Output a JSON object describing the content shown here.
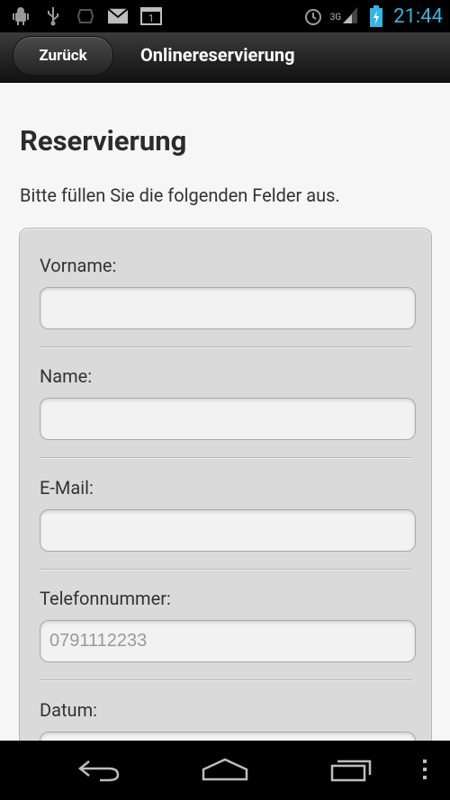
{
  "status_bar": {
    "time": "21:44",
    "network": "3G",
    "calendar_day": "1",
    "icons": [
      "android-debug-icon",
      "usb-icon",
      "notification-icon",
      "mail-icon",
      "calendar-icon",
      "alarm-icon",
      "signal-icon",
      "battery-charging-icon"
    ]
  },
  "header": {
    "back_label": "Zurück",
    "title": "Onlinereservierung"
  },
  "page": {
    "title": "Reservierung",
    "intro": "Bitte füllen Sie die folgenden Felder aus."
  },
  "form": {
    "fields": [
      {
        "label": "Vorname:",
        "value": "",
        "placeholder": ""
      },
      {
        "label": "Name:",
        "value": "",
        "placeholder": ""
      },
      {
        "label": "E-Mail:",
        "value": "",
        "placeholder": ""
      },
      {
        "label": "Telefonnummer:",
        "value": "",
        "placeholder": "0791112233"
      },
      {
        "label": "Datum:",
        "value": "",
        "placeholder": ""
      }
    ]
  },
  "navbar": {
    "icons": [
      "back-nav-icon",
      "home-nav-icon",
      "recent-apps-icon",
      "overflow-menu-icon"
    ]
  },
  "colors": {
    "accent": "#33b5e5",
    "header_dark": "#1c1c1c",
    "form_bg": "#dadada"
  }
}
